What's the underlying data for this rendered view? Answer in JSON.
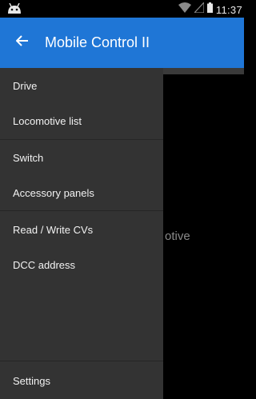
{
  "status_bar": {
    "time": "11:37",
    "icons": [
      "android-icon",
      "wifi-icon",
      "signal-icon",
      "battery-icon"
    ]
  },
  "action_bar": {
    "title": "Mobile Control II",
    "color": "#1f76d6"
  },
  "background": {
    "partial_text": "otive"
  },
  "drawer": {
    "background": "#333333",
    "items": [
      {
        "label": "Drive"
      },
      {
        "label": "Locomotive list"
      },
      {
        "label": "Switch"
      },
      {
        "label": "Accessory panels"
      },
      {
        "label": "Read / Write CVs"
      },
      {
        "label": "DCC address"
      }
    ],
    "footer_item": {
      "label": "Settings"
    }
  }
}
